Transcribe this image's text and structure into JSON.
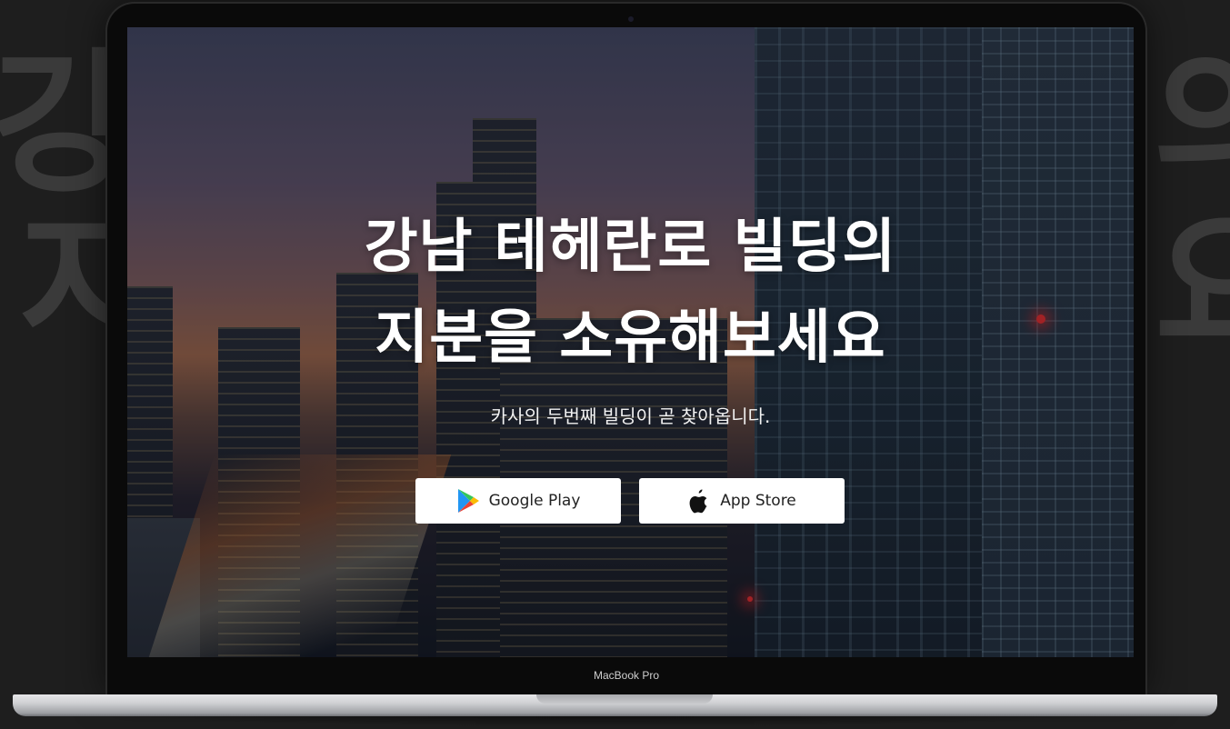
{
  "background": {
    "left_line1": "강",
    "left_line2": "지",
    "right_line1": "의",
    "right_line2": "요"
  },
  "hero": {
    "title_line1": "강남 테헤란로 빌딩의",
    "title_line2": "지분을 소유해보세요",
    "subtitle": "카사의 두번째 빌딩이 곧 찾아옵니다."
  },
  "buttons": {
    "google_play_label": "Google Play",
    "app_store_label": "App Store"
  },
  "device": {
    "label": "MacBook Pro"
  },
  "colors": {
    "button_bg": "#ffffff",
    "title_text": "#ffffff",
    "page_bg": "#1e1e1e"
  }
}
